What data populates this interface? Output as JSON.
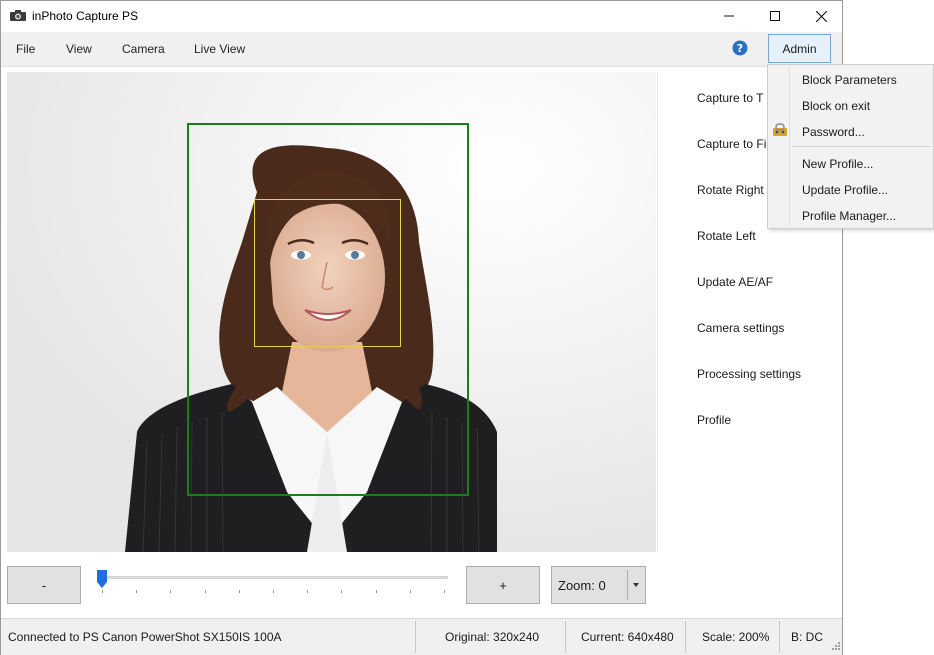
{
  "window": {
    "title": "inPhoto Capture PS"
  },
  "menu": {
    "items": [
      "File",
      "View",
      "Camera",
      "Live View"
    ],
    "admin_label": "Admin"
  },
  "side_actions": [
    "Capture to T",
    "Capture to Fi",
    "Rotate Right",
    "Rotate Left",
    "Update AE/AF",
    "Camera settings",
    "Processing settings",
    "Profile"
  ],
  "admin_menu": {
    "items": [
      "Block Parameters",
      "Block on exit",
      "Password...",
      "New Profile...",
      "Update Profile...",
      "Profile Manager..."
    ]
  },
  "controls": {
    "minus_label": "-",
    "plus_label": "+",
    "zoom_label": "Zoom: 0",
    "zoom_value": 0
  },
  "status": {
    "connection": "Connected to PS Canon PowerShot SX150IS 100A",
    "original": "Original: 320x240",
    "current": "Current: 640x480",
    "scale": "Scale: 200%",
    "mode": "B: DC"
  },
  "colors": {
    "crop_frame": "#1a7f1a",
    "face_frame": "#e3d24a",
    "slider_thumb": "#1e6fd9",
    "help_icon": "#2a6fc0"
  },
  "icons": {
    "app": "camera-icon",
    "help": "help-icon",
    "password": "key-lock-icon"
  }
}
